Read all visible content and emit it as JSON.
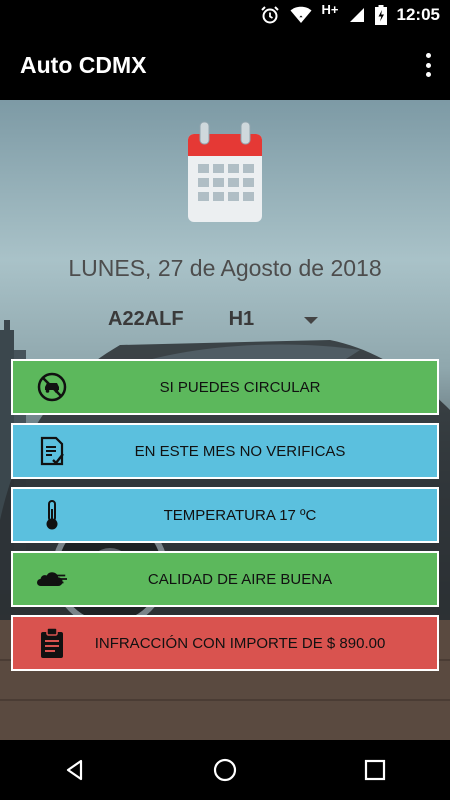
{
  "status_bar": {
    "network": "H+",
    "time": "12:05"
  },
  "app_bar": {
    "title": "Auto CDMX"
  },
  "main": {
    "date": "LUNES, 27 de Agosto de 2018",
    "plate": "A22ALF",
    "hologram": "H1"
  },
  "cards": [
    {
      "label": "SI PUEDES CIRCULAR",
      "color": "#5cb85c",
      "icon": "no-car-icon"
    },
    {
      "label": "EN ESTE MES NO VERIFICAS",
      "color": "#5bc0de",
      "icon": "document-check-icon"
    },
    {
      "label": "TEMPERATURA 17 ºC",
      "color": "#5bc0de",
      "icon": "thermometer-icon"
    },
    {
      "label": "CALIDAD DE AIRE BUENA",
      "color": "#5cb85c",
      "icon": "cloud-wind-icon"
    },
    {
      "label": "INFRACCIÓN CON IMPORTE DE $ 890.00",
      "color": "#d9534f",
      "icon": "clipboard-icon"
    }
  ]
}
